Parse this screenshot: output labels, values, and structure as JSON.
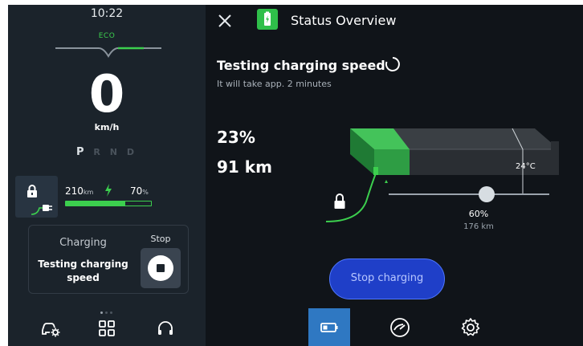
{
  "left_panel": {
    "clock": "10:22",
    "drive_mode": "ECO",
    "speed": "0",
    "speed_unit": "km/h",
    "gears": [
      "P",
      "R",
      "N",
      "D"
    ],
    "active_gear": "P",
    "range_value": "210",
    "range_unit": "km",
    "battery_percent_value": "70",
    "battery_percent_unit": "%",
    "battery_level_fraction": 0.7,
    "charging_card": {
      "title": "Charging",
      "message": "Testing charging speed",
      "stop_label": "Stop"
    },
    "pager_count": 3,
    "pager_active": 0,
    "nav_icons": [
      "car-settings-icon",
      "grid-icon",
      "headset-icon"
    ]
  },
  "right_panel": {
    "window_title": "Status Overview",
    "testing_title": "Testing charging speed",
    "testing_subtitle": "It will take app. 2 minutes",
    "charge_percent": "23%",
    "charge_range": "91 km",
    "battery_fill_fraction": 0.23,
    "temperature": "24°C",
    "charge_limit_fraction": 0.6,
    "charge_limit_percent": "60%",
    "charge_limit_range": "176 km",
    "stop_button_label": "Stop charging",
    "nav_tabs": [
      "battery-icon",
      "speedometer-icon",
      "gear-icon"
    ],
    "active_tab": "battery-icon"
  },
  "colors": {
    "accent_green": "#3ccf4e",
    "stop_button_blue": "#1f3fc8",
    "active_tab_blue": "#2f78c2",
    "background": "#101419",
    "left_panel_bg": "#1b232b"
  }
}
